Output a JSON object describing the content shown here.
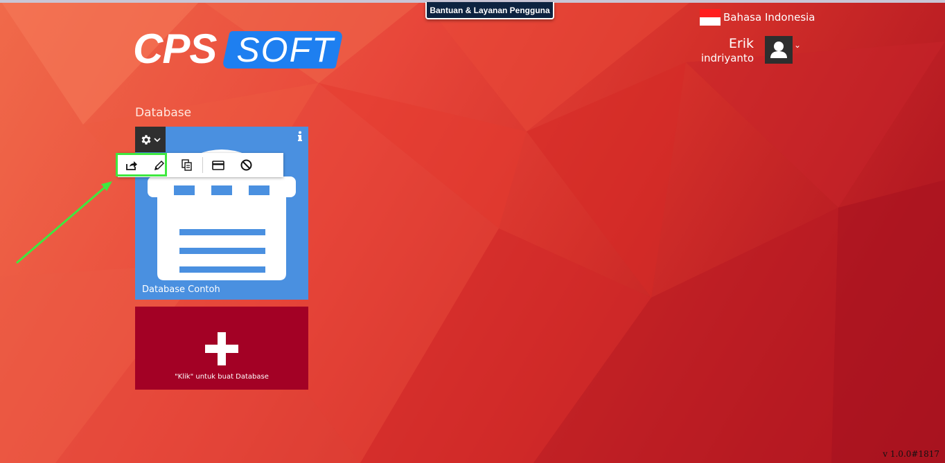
{
  "header": {
    "help_label": "Bantuan & Layanan Pengguna",
    "logo_left": "CPS",
    "logo_right": "SOFT"
  },
  "language": {
    "label": "Bahasa Indonesia",
    "flag": "indonesia-flag"
  },
  "user": {
    "first_name": "Erik",
    "last_name": "indriyanto",
    "caret": "⌄"
  },
  "main": {
    "section_title": "Database",
    "database_card": {
      "name": "Database Contoh",
      "color": "#4a90e0"
    },
    "toolbar": {
      "items": [
        "share-icon",
        "pencil-icon",
        "copy-icon",
        "card-icon",
        "block-icon"
      ]
    },
    "add_card": {
      "label": "\"Klik\" untuk buat Database",
      "color": "#a30125"
    }
  },
  "footer": {
    "version": "v 1.0.0#1817"
  },
  "colors": {
    "accent_blue": "#1e7ff0",
    "highlight_green": "#3fe83f",
    "help_bg": "#0d2340"
  }
}
